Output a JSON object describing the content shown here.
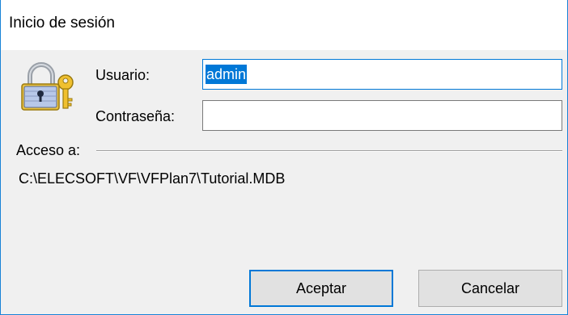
{
  "window": {
    "title": "Inicio de sesión"
  },
  "form": {
    "user_label": "Usuario:",
    "user_value": "admin",
    "password_label": "Contraseña:",
    "password_value": ""
  },
  "access": {
    "group_label": "Acceso a:",
    "path": "C:\\ELECSOFT\\VF\\VFPlan7\\Tutorial.MDB"
  },
  "buttons": {
    "ok_label": "Aceptar",
    "cancel_label": "Cancelar"
  },
  "icons": {
    "lock_icon": "padlock-with-key"
  },
  "colors": {
    "accent": "#0078d7",
    "window_border": "#1883d7",
    "dialog_bg": "#f0f0f0",
    "button_bg": "#e1e1e1"
  }
}
